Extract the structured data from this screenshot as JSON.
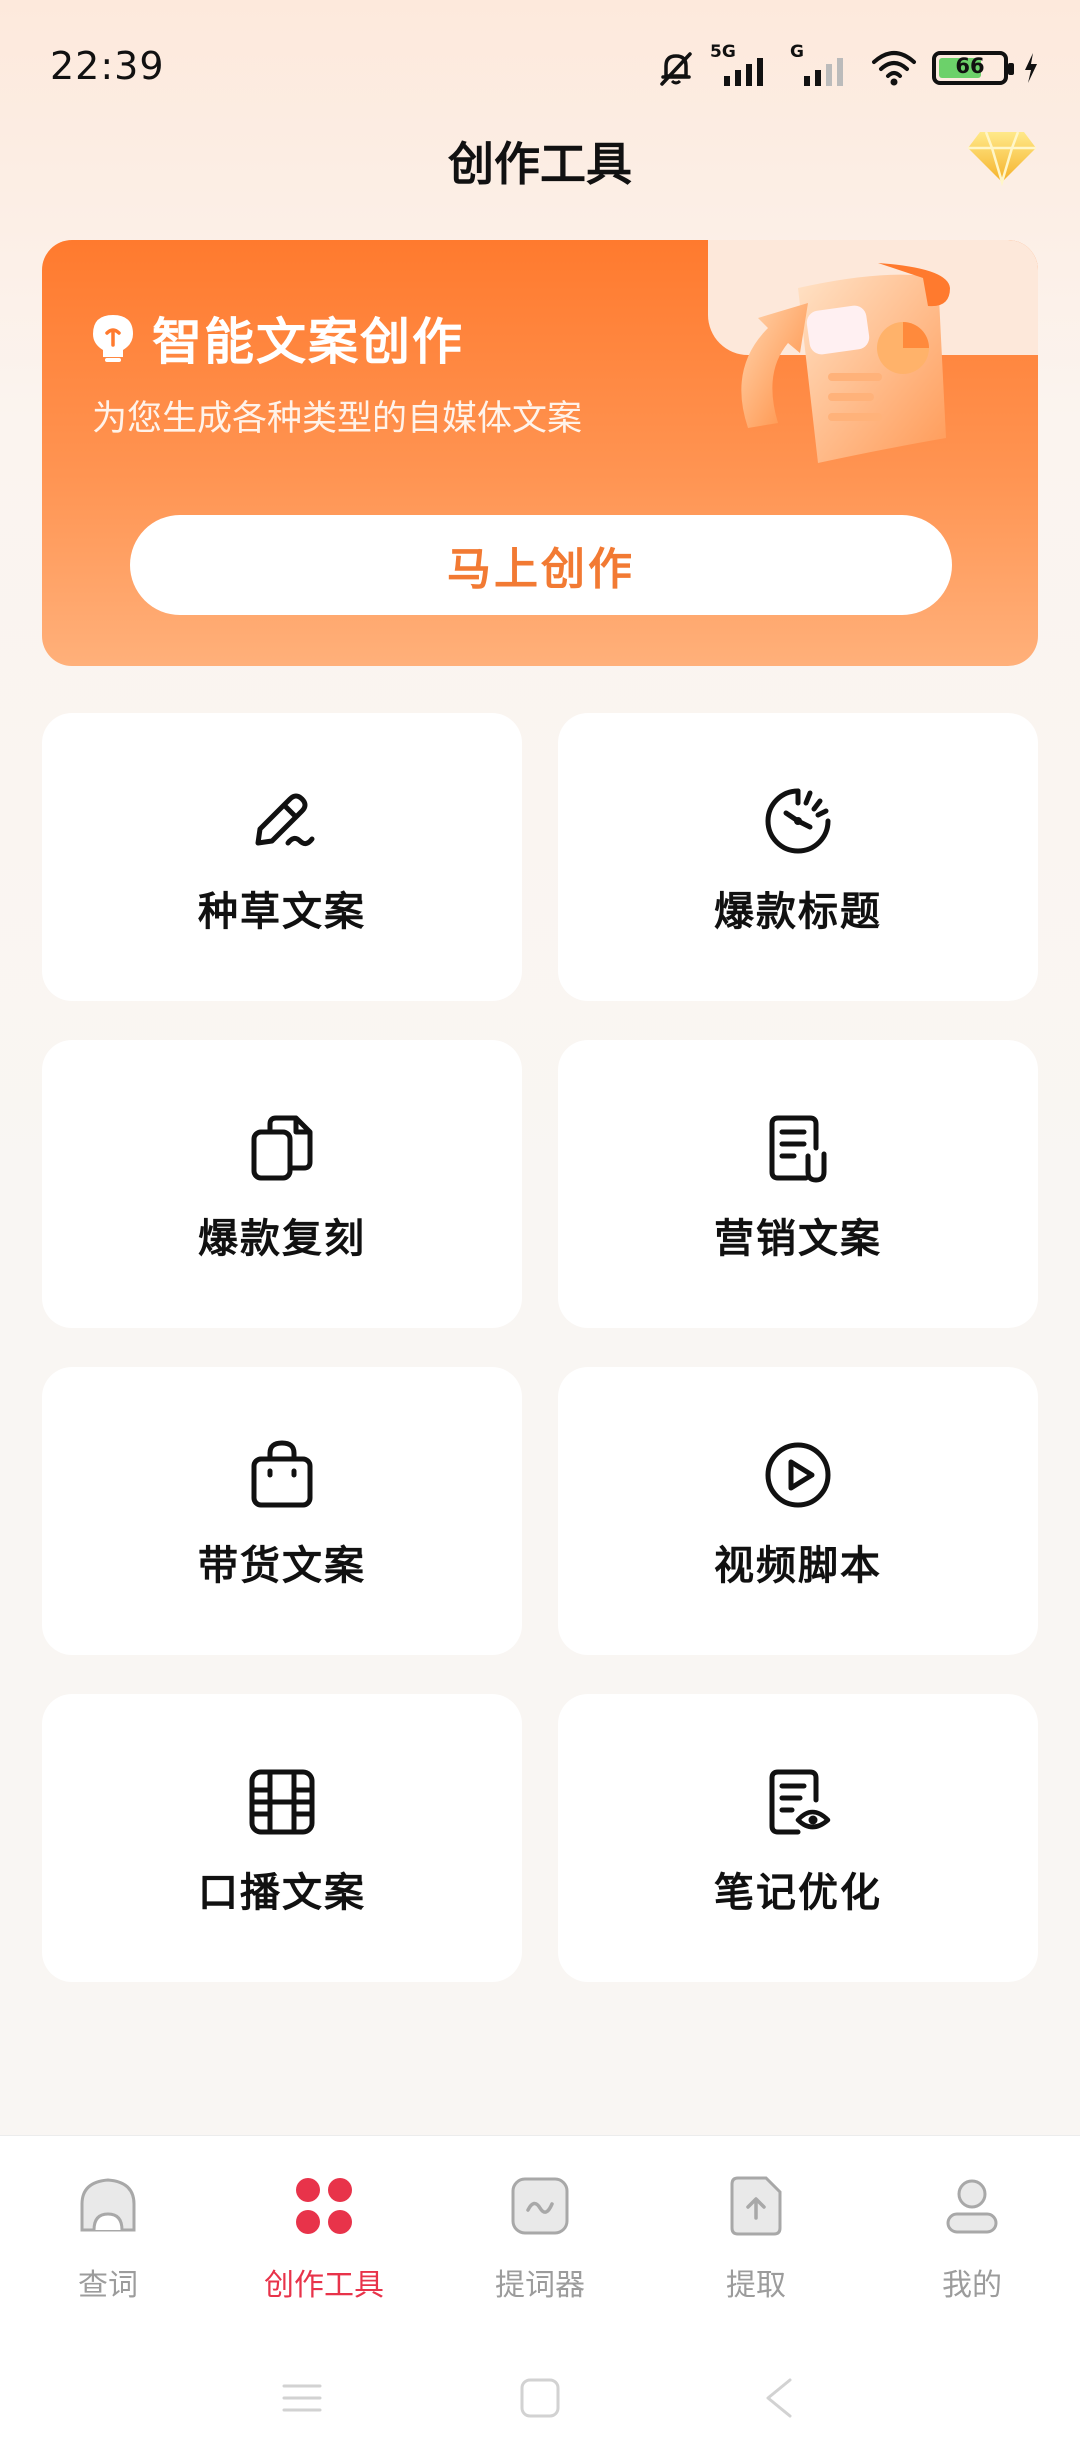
{
  "status_bar": {
    "time": "22:39",
    "network_1": "5G",
    "network_2": "G",
    "battery": "66"
  },
  "header": {
    "title": "创作工具"
  },
  "banner": {
    "title": "智能文案创作",
    "subtitle": "为您生成各种类型的自媒体文案",
    "cta_label": "马上创作"
  },
  "tools": [
    {
      "label": "种草文案",
      "icon": "pen-icon"
    },
    {
      "label": "爆款标题",
      "icon": "timer-icon"
    },
    {
      "label": "爆款复刻",
      "icon": "copy-icon"
    },
    {
      "label": "营销文案",
      "icon": "document-clip-icon"
    },
    {
      "label": "带货文案",
      "icon": "shopping-bag-icon"
    },
    {
      "label": "视频脚本",
      "icon": "play-circle-icon"
    },
    {
      "label": "口播文案",
      "icon": "film-icon"
    },
    {
      "label": "笔记优化",
      "icon": "document-eye-icon"
    }
  ],
  "bottom_nav": [
    {
      "label": "查词",
      "icon": "home-icon",
      "active": false
    },
    {
      "label": "创作工具",
      "icon": "grid-icon",
      "active": true
    },
    {
      "label": "提词器",
      "icon": "prompter-icon",
      "active": false
    },
    {
      "label": "提取",
      "icon": "upload-file-icon",
      "active": false
    },
    {
      "label": "我的",
      "icon": "user-icon",
      "active": false
    }
  ],
  "colors": {
    "accent_orange": "#ff7a2e",
    "active_tab": "#e8334a",
    "inactive_tab": "#9c9c9c"
  }
}
